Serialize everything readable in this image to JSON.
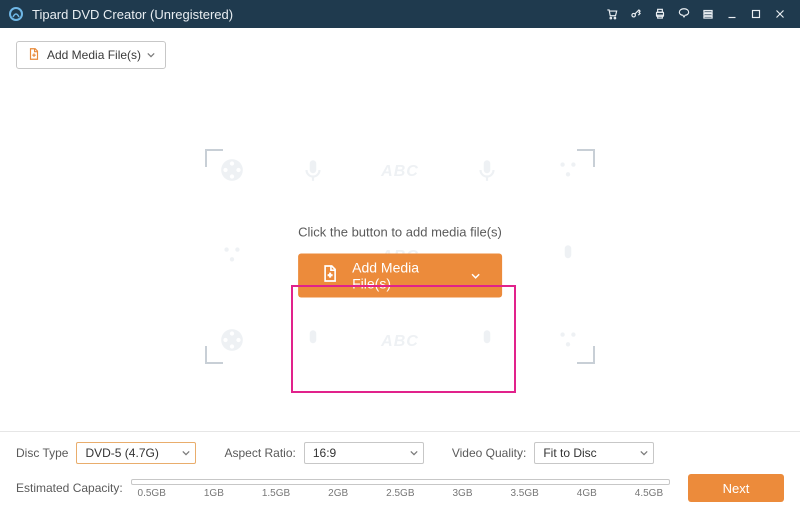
{
  "titlebar": {
    "title": "Tipard DVD Creator (Unregistered)"
  },
  "toolbar": {
    "add_label": "Add Media File(s)"
  },
  "stage": {
    "prompt": "Click the button to add media file(s)",
    "add_label": "Add Media File(s)",
    "ghost_text": "ABC"
  },
  "bottom": {
    "disc_type_label": "Disc Type",
    "disc_type_value": "DVD-5 (4.7G)",
    "aspect_label": "Aspect Ratio:",
    "aspect_value": "16:9",
    "quality_label": "Video Quality:",
    "quality_value": "Fit to Disc",
    "capacity_label": "Estimated Capacity:",
    "ticks": [
      "0.5GB",
      "1GB",
      "1.5GB",
      "2GB",
      "2.5GB",
      "3GB",
      "3.5GB",
      "4GB",
      "4.5GB"
    ],
    "next_label": "Next"
  },
  "colors": {
    "accent": "#ec8b3b",
    "titlebar": "#1f3a4e",
    "highlight": "#e1228b"
  }
}
